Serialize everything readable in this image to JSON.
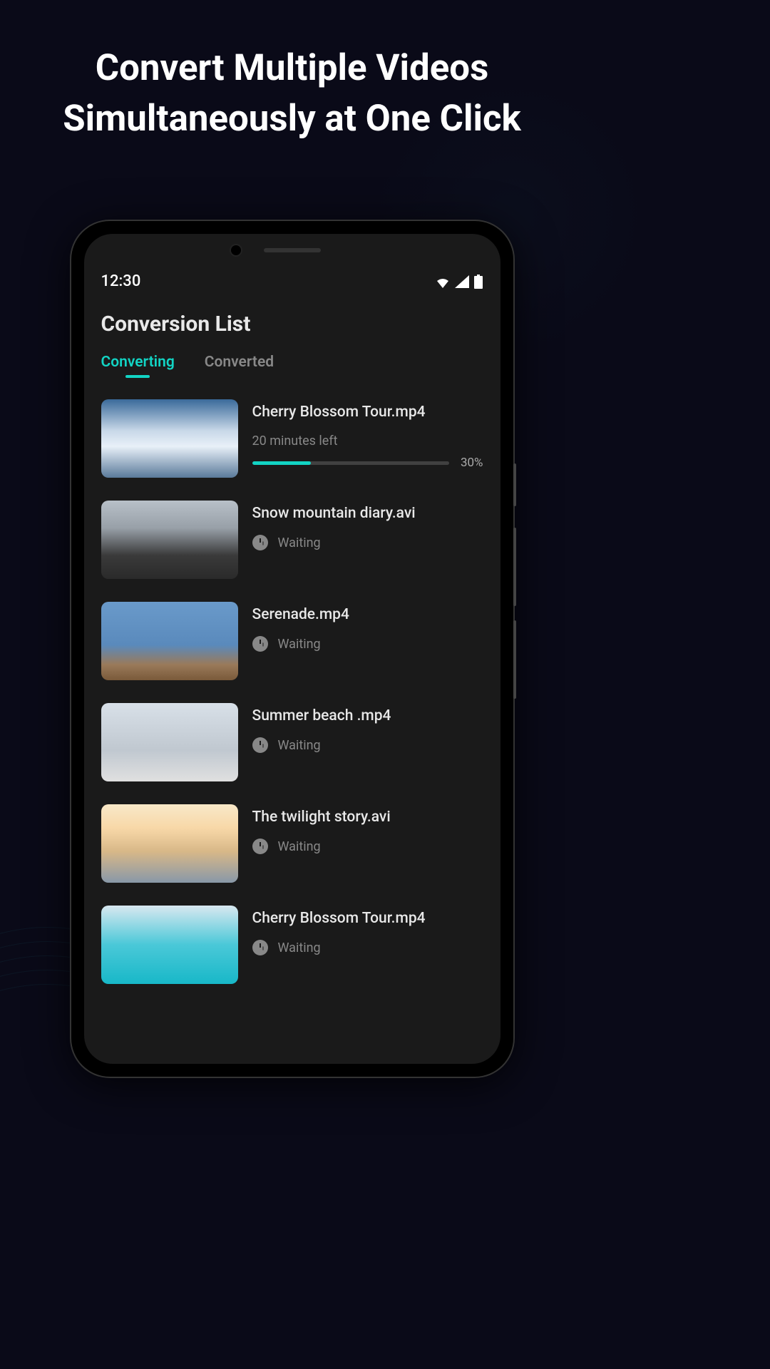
{
  "headline": "Convert Multiple Videos Simultaneously at One Click",
  "status": {
    "time": "12:30"
  },
  "screen": {
    "title": "Conversion List"
  },
  "tabs": [
    {
      "label": "Converting",
      "active": true
    },
    {
      "label": "Converted",
      "active": false
    }
  ],
  "accent_color": "#12d4c4",
  "items": [
    {
      "title": "Cherry Blossom Tour.mp4",
      "status_type": "progress",
      "status_text": "20 minutes left",
      "progress_pct": "30%",
      "progress_value": 30
    },
    {
      "title": "Snow mountain diary.avi",
      "status_type": "waiting",
      "status_text": "Waiting"
    },
    {
      "title": "Serenade.mp4",
      "status_type": "waiting",
      "status_text": "Waiting"
    },
    {
      "title": "Summer beach .mp4",
      "status_type": "waiting",
      "status_text": "Waiting"
    },
    {
      "title": "The twilight story.avi",
      "status_type": "waiting",
      "status_text": "Waiting"
    },
    {
      "title": "Cherry Blossom Tour.mp4",
      "status_type": "waiting",
      "status_text": "Waiting"
    }
  ]
}
